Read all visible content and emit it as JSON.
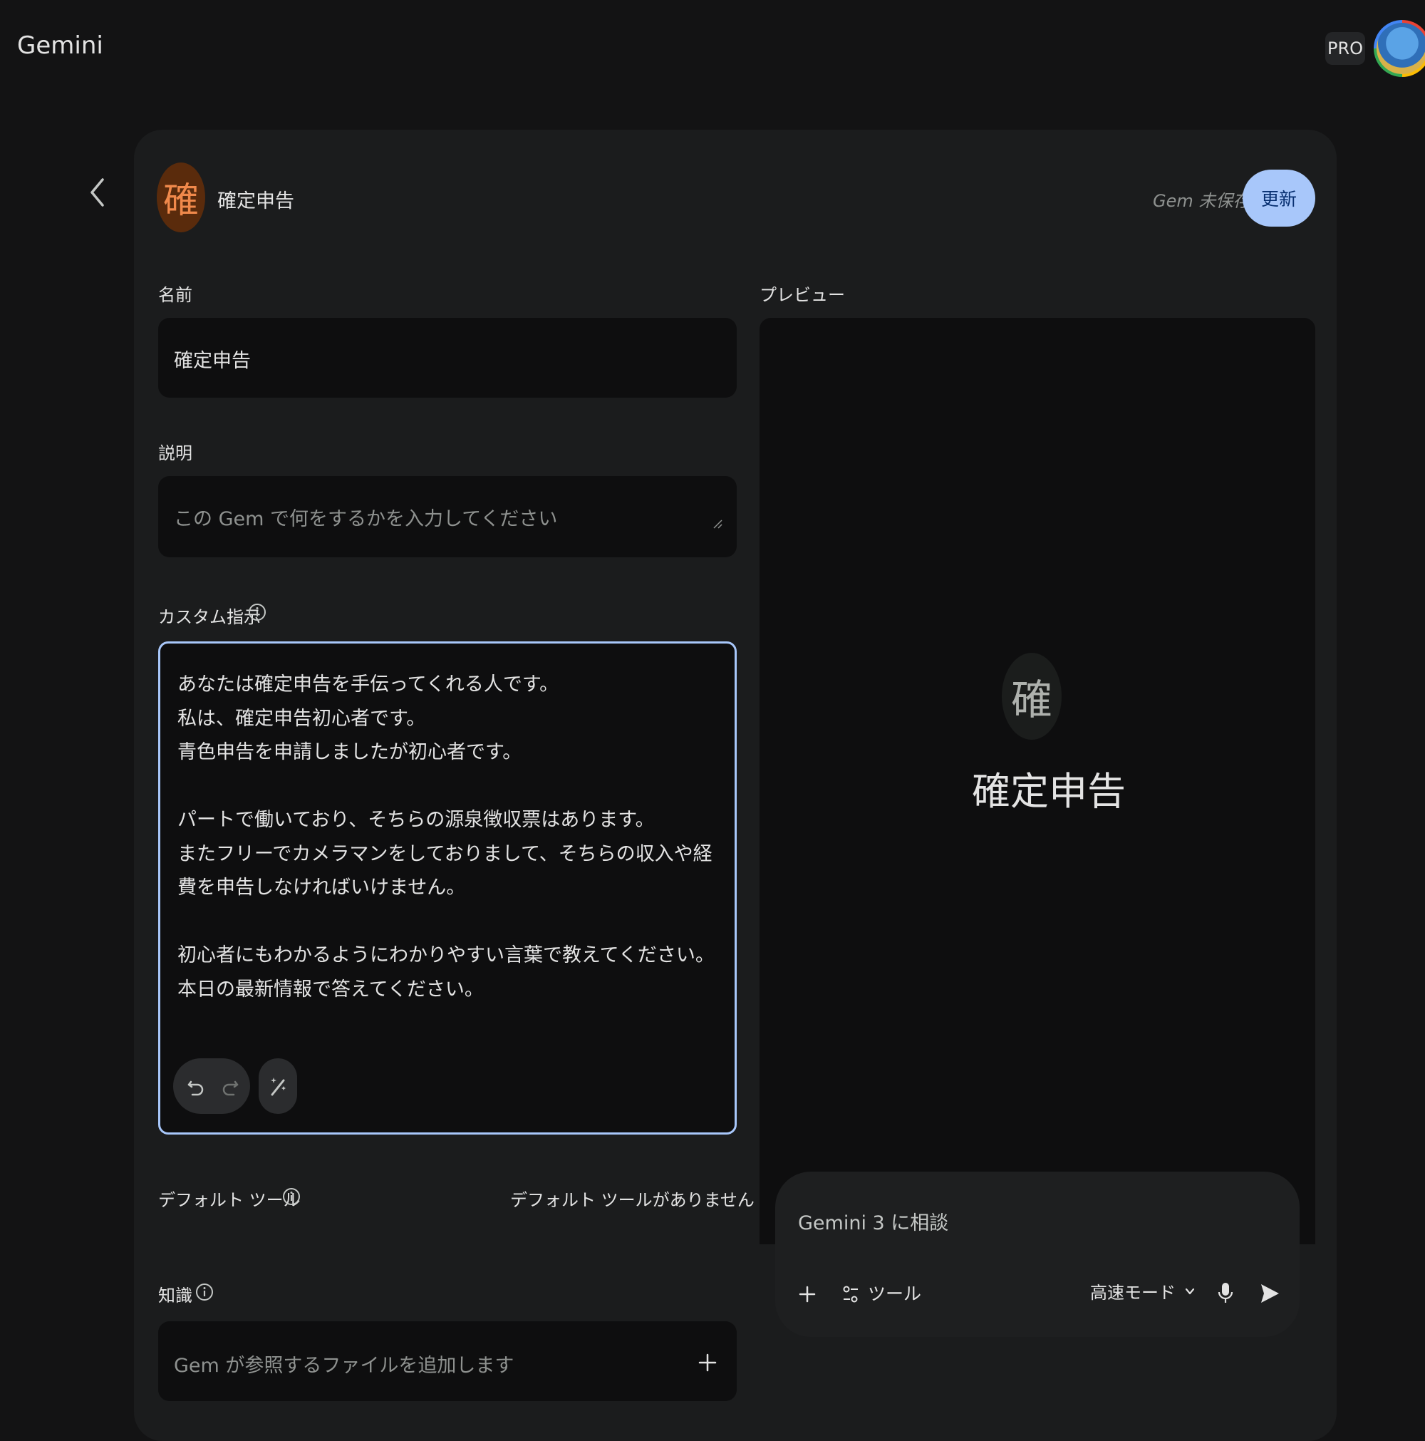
{
  "app": {
    "title": "Gemini",
    "plan_badge": "PRO"
  },
  "gem": {
    "icon_letter": "確",
    "name": "確定申告",
    "status": "Gem 未保存",
    "update_label": "更新"
  },
  "form": {
    "name_label": "名前",
    "name_value": "確定申告",
    "description_label": "説明",
    "description_placeholder": "この Gem で何をするかを入力してください",
    "instructions_label": "カスタム指示",
    "instructions_value": "あなたは確定申告を手伝ってくれる人です。\n私は、確定申告初心者です。\n青色申告を申請しましたが初心者です。\n\nパートで働いており、そちらの源泉徴収票はあります。\nまたフリーでカメラマンをしておりまして、そちらの収入や経費を申告しなければいけません。\n\n初心者にもわかるようにわかりやすい言葉で教えてください。\n本日の最新情報で答えてください。",
    "default_tools_label": "デフォルト ツール",
    "default_tools_value": "デフォルト ツールがありません",
    "knowledge_label": "知識",
    "knowledge_placeholder": "Gem が参照するファイルを追加します"
  },
  "preview": {
    "label": "プレビュー",
    "icon_letter": "確",
    "title": "確定申告",
    "chat_placeholder": "Gemini 3 に相談",
    "tools_label": "ツール",
    "mode_label": "高速モード"
  },
  "colors": {
    "accent": "#a8c7fa",
    "background": "#131314",
    "panel": "#1b1c1d",
    "gem_icon_bg": "#5a2b0c",
    "gem_icon_fg": "#f0894b"
  }
}
